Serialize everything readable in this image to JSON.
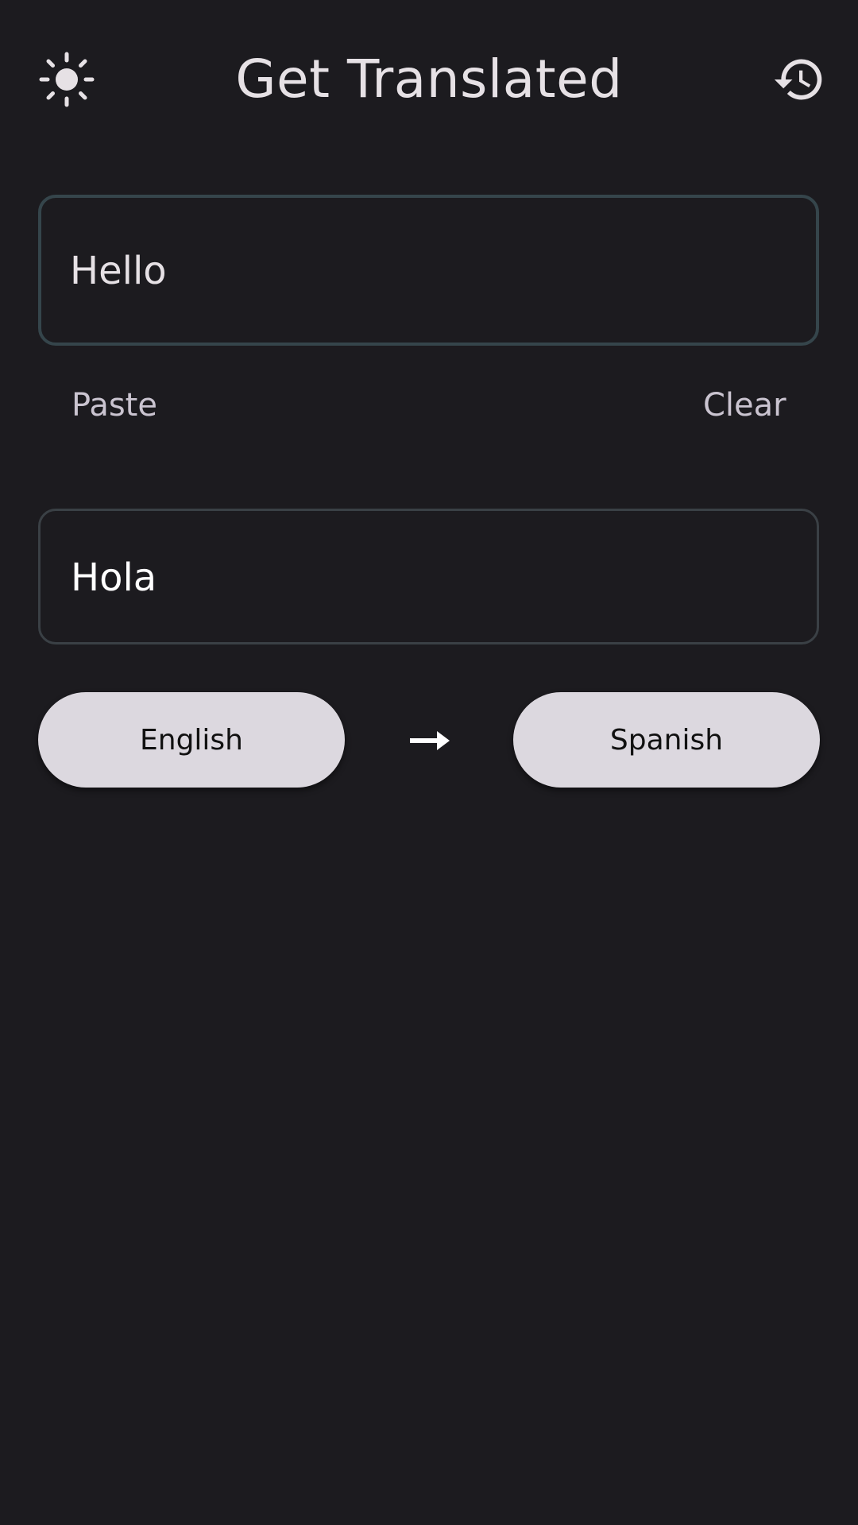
{
  "header": {
    "title": "Get Translated",
    "left_icon": "sun-icon",
    "right_icon": "history-icon"
  },
  "input": {
    "value": "Hello"
  },
  "actions": {
    "paste_label": "Paste",
    "clear_label": "Clear"
  },
  "output": {
    "value": "Hola"
  },
  "languages": {
    "source": "English",
    "target": "Spanish",
    "arrow_icon": "arrow-right-icon"
  },
  "colors": {
    "background": "#1c1b1f",
    "text": "#e6e1e5",
    "input_border": "#35454b",
    "button_fill": "#dcd8df"
  }
}
